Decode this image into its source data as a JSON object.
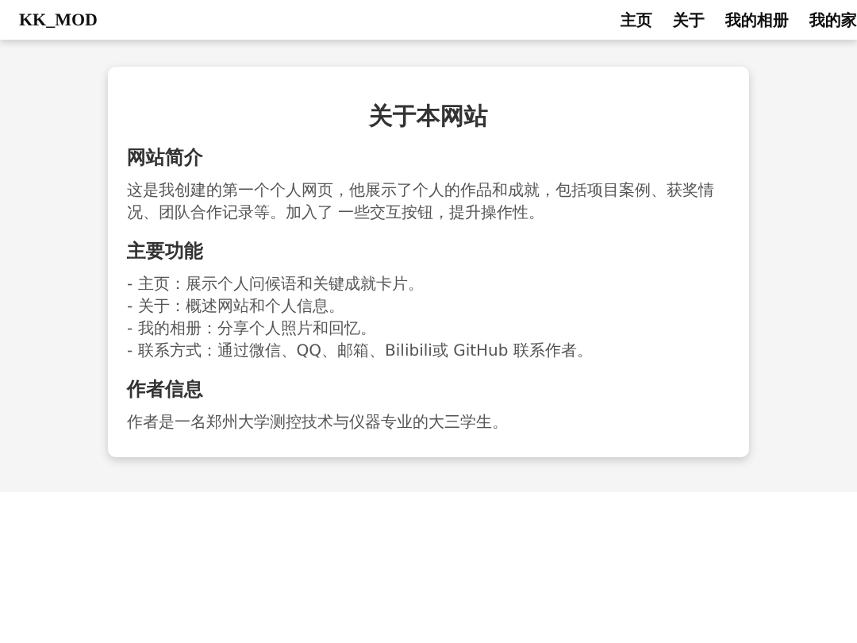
{
  "header": {
    "logo": "KK_MOD",
    "nav": [
      {
        "label": "主页"
      },
      {
        "label": "关于"
      },
      {
        "label": "我的相册"
      },
      {
        "label": "我的家"
      }
    ]
  },
  "card": {
    "title": "关于本网站",
    "sections": [
      {
        "heading": "网站简介",
        "lines": [
          "这是我创建的第一个个人网页，他展示了个人的作品和成就，包括项目案例、获奖情况、团队合作记录等。加入了 一些交互按钮，提升操作性。"
        ]
      },
      {
        "heading": "主要功能",
        "lines": [
          "- 主页：展示个人问候语和关键成就卡片。",
          "- 关于：概述网站和个人信息。",
          "- 我的相册：分享个人照片和回忆。",
          "- 联系方式：通过微信、QQ、邮箱、Bilibili或 GitHub 联系作者。"
        ]
      },
      {
        "heading": "作者信息",
        "lines": [
          "作者是一名郑州大学测控技术与仪器专业的大三学生。"
        ]
      }
    ]
  }
}
